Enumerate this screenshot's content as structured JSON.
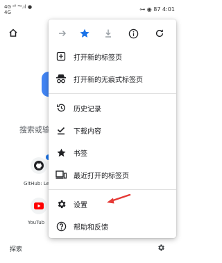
{
  "status_bar": {
    "left_text": "4G ᵃˡˡ ⁴ᴳ.ıl ●\n4G",
    "right_text": "⊶ ◉ 87 4:01"
  },
  "background": {
    "search_hint": "搜索或输...",
    "tiles": [
      {
        "label": "GitHub: Le",
        "icon": "github-icon"
      },
      {
        "label": "YouTub",
        "icon": "youtube-icon"
      }
    ],
    "bottom_label": "探索"
  },
  "menu": {
    "toolbar": [
      {
        "name": "forward-icon"
      },
      {
        "name": "bookmark-star-icon"
      },
      {
        "name": "download-icon"
      },
      {
        "name": "info-icon"
      },
      {
        "name": "refresh-icon"
      }
    ],
    "items": [
      {
        "label": "打开新的标签页",
        "icon": "new-tab-icon"
      },
      {
        "label": "打开新的无痕式标签页",
        "icon": "incognito-icon"
      },
      {
        "label": "历史记录",
        "icon": "history-icon"
      },
      {
        "label": "下载内容",
        "icon": "downloads-icon"
      },
      {
        "label": "书签",
        "icon": "bookmarks-icon"
      },
      {
        "label": "最近打开的标签页",
        "icon": "recent-tabs-icon"
      },
      {
        "label": "设置",
        "icon": "settings-icon"
      },
      {
        "label": "帮助和反馈",
        "icon": "help-icon"
      }
    ]
  },
  "colors": {
    "accent": "#1a73e8",
    "annotation_arrow": "#e53935",
    "youtube_red": "#ff0000"
  }
}
